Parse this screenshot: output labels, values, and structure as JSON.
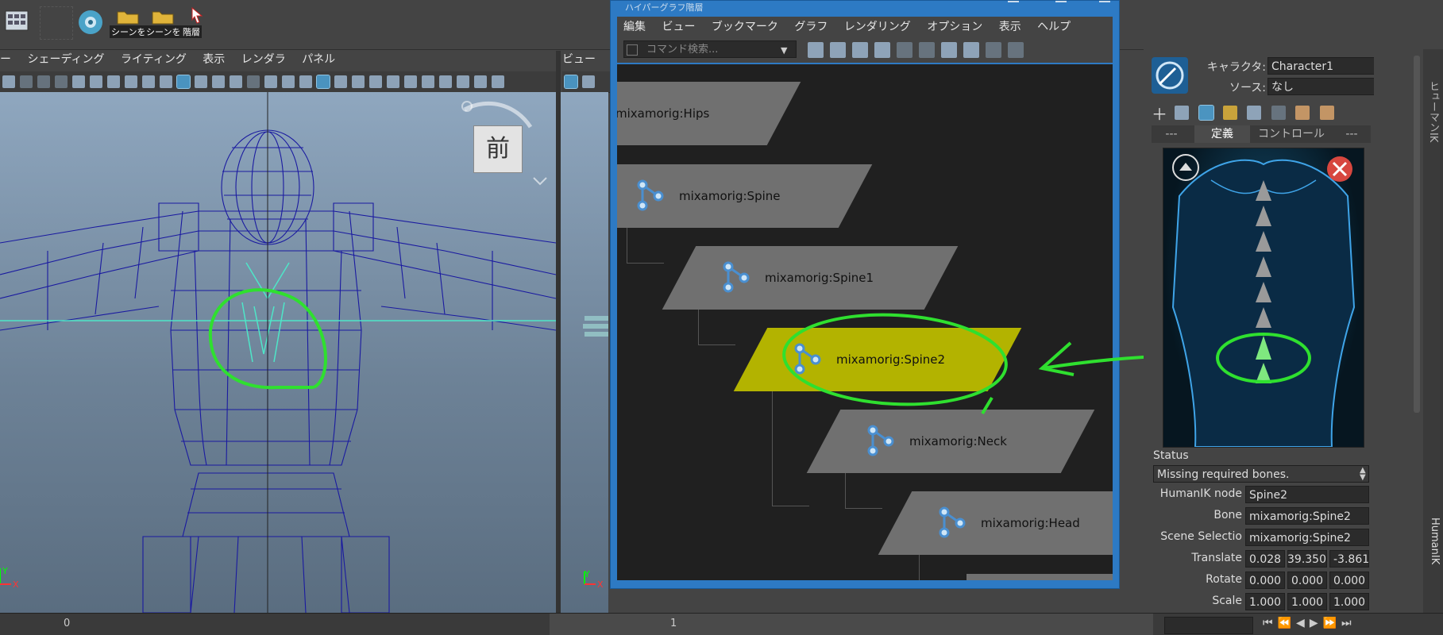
{
  "shelf": {
    "buttons": [
      {
        "name": "grid-app-icon",
        "caption": ""
      },
      {
        "name": "render-sphere-icon",
        "caption": ""
      },
      {
        "name": "open-scene-icon",
        "caption": "シーンを"
      },
      {
        "name": "open-scene-icon",
        "caption": "シーンを"
      },
      {
        "name": "cursor-icon",
        "caption": "階層"
      }
    ]
  },
  "left_viewport": {
    "menu": [
      "ー",
      "シェーディング",
      "ライティング",
      "表示",
      "レンダラ",
      "パネル"
    ],
    "view_cube_label": "前",
    "axis_x": "X",
    "axis_y": "Y"
  },
  "mid_viewport": {
    "menu": [
      "ビュー"
    ],
    "axis_x": "X",
    "axis_y": "Y"
  },
  "hypergraph": {
    "title": "ハイパーグラフ階層",
    "menu": [
      "編集",
      "ビュー",
      "ブックマーク",
      "グラフ",
      "レンダリング",
      "オプション",
      "表示",
      "ヘルプ"
    ],
    "command_search_placeholder": "コマンド検索...",
    "nodes": [
      {
        "label": "mixamorig:Hips",
        "selected": false
      },
      {
        "label": "mixamorig:Spine",
        "selected": false
      },
      {
        "label": "mixamorig:Spine1",
        "selected": false
      },
      {
        "label": "mixamorig:Spine2",
        "selected": true
      },
      {
        "label": "mixamorig:Neck",
        "selected": false
      },
      {
        "label": "mixamorig:Head",
        "selected": false
      }
    ],
    "selected_color": "#b3b300",
    "node_color": "#707070"
  },
  "humanik": {
    "character_label": "キャラクタ:",
    "character_value": "Character1",
    "source_label": "ソース:",
    "source_value": "なし",
    "tabs": [
      {
        "label": "---",
        "active": false
      },
      {
        "label": "定義",
        "active": true
      },
      {
        "label": "コントロール",
        "active": false
      },
      {
        "label": "---",
        "active": false
      }
    ],
    "status_heading": "Status",
    "status_value": "Missing required bones.",
    "fields": {
      "humanik_node_label": "HumanIK node",
      "humanik_node_value": "Spine2",
      "bone_label": "Bone",
      "bone_value": "mixamorig:Spine2",
      "scene_selection_label": "Scene Selectio",
      "scene_selection_value": "mixamorig:Spine2",
      "translate_label": "Translate",
      "translate_values": [
        "0.028",
        "39.350",
        "-3.861"
      ],
      "rotate_label": "Rotate",
      "rotate_values": [
        "0.000",
        "0.000",
        "0.000"
      ],
      "scale_label": "Scale",
      "scale_values": [
        "1.000",
        "1.000",
        "1.000"
      ]
    },
    "side_tabs_text": "ヒューマンIK",
    "vertical_tab": "HumanIK"
  },
  "timeline": {
    "tick_0": "0",
    "tick_1": "1"
  },
  "annotation_color": "#2fe02f"
}
